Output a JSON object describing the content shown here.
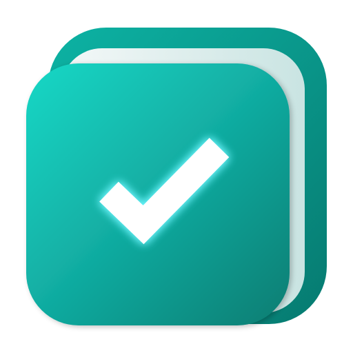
{
  "icon": {
    "name": "checkmark-notebook-app-icon",
    "glyph": "check-icon",
    "colors": {
      "background": "#ffffff",
      "back_cover_light": "#0db3a4",
      "back_cover_dark": "#067a70",
      "pages_light": "#f4f8f8",
      "pages_shadow": "#c9e4e2",
      "cover_top_left": "#14d8c6",
      "cover_mid": "#12b0a5",
      "cover_bottom_right": "#067d72",
      "check_fill": "#ffffff",
      "check_glow": "#6ff7ff"
    }
  }
}
